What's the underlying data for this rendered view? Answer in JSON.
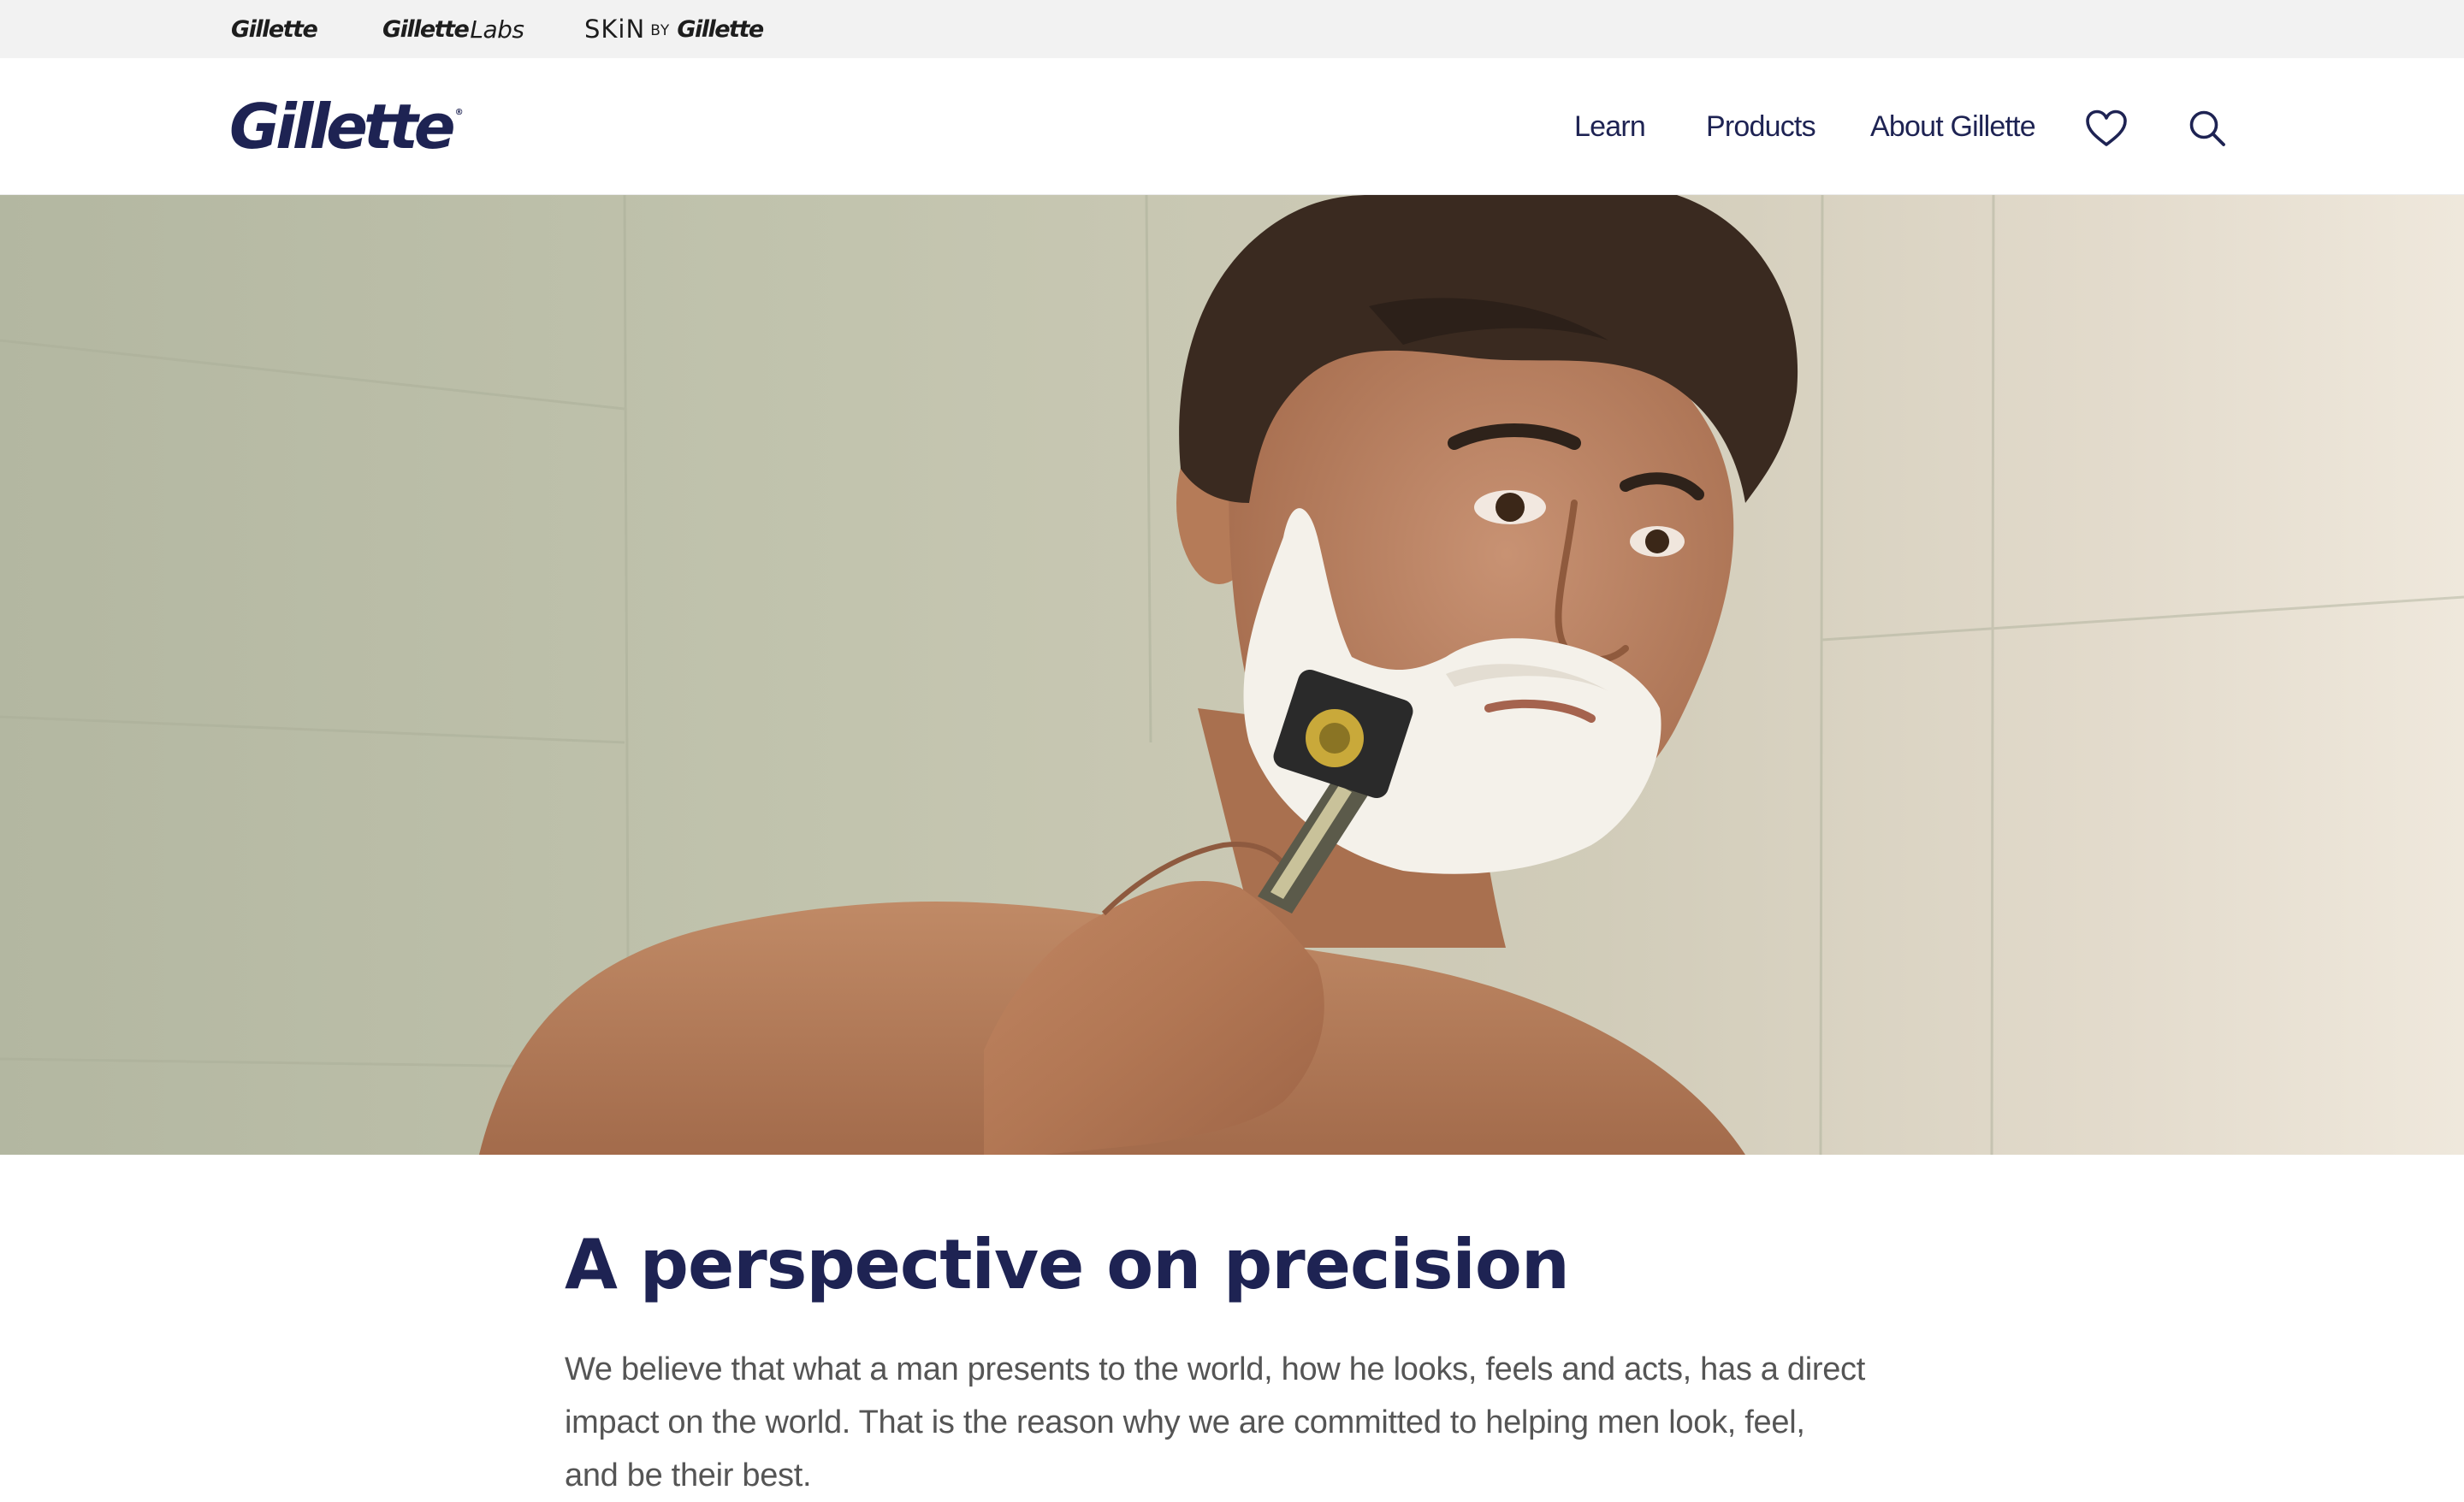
{
  "brand_strip": {
    "gillette": "Gillette",
    "gillette_labs_bold": "Gillette",
    "gillette_labs_light": "Labs",
    "skin": "SKiN",
    "skin_by": "BY",
    "skin_gillette": "Gillette"
  },
  "header": {
    "logo": "Gillette",
    "logo_mark": "®",
    "nav": {
      "learn": "Learn",
      "products": "Products",
      "about": "About Gillette"
    },
    "icons": {
      "wishlist": "heart-icon",
      "search": "search-icon"
    }
  },
  "hero": {
    "image": "man-shaving-hero-image"
  },
  "article": {
    "headline": "A perspective on precision",
    "body": "We believe that what a man presents to the world, how he looks, feels and acts, has a direct impact on the world. That is the reason why we are committed to helping men look, feel, and be their best."
  },
  "colors": {
    "brand_navy": "#1e2353",
    "strip_background": "#f2f2f2",
    "body_text": "#555555"
  }
}
